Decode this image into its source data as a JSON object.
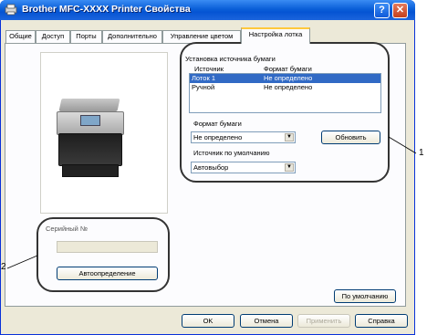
{
  "window": {
    "title": "Brother MFC-XXXX Printer Свойства",
    "help_glyph": "?",
    "close_glyph": "✕"
  },
  "tabs": [
    {
      "label": "Общие"
    },
    {
      "label": "Доступ"
    },
    {
      "label": "Порты"
    },
    {
      "label": "Дополнительно"
    },
    {
      "label": "Управление цветом"
    },
    {
      "label": "Настройка лотка"
    }
  ],
  "paper_source": {
    "group_title": "Установка источника бумаги",
    "col_source": "Источник",
    "col_format": "Формат бумаги",
    "rows": [
      {
        "source": "Лоток 1",
        "format": "Не определено"
      },
      {
        "source": "Ручной",
        "format": "Не определено"
      }
    ],
    "format_label": "Формат бумаги",
    "format_value": "Не определено",
    "update_button": "Обновить",
    "default_source_label": "Источник по умолчанию",
    "default_source_value": "Автовыбор"
  },
  "serial": {
    "group_title": "Серийный №",
    "value": "",
    "autodetect_button": "Автоопределение"
  },
  "buttons": {
    "defaults": "По умолчанию",
    "ok": "OK",
    "cancel": "Отмена",
    "apply": "Применить",
    "help": "Справка"
  },
  "callouts": {
    "one": "1",
    "two": "2"
  },
  "colors": {
    "selection": "#316ac5",
    "titlebar": "#0a5fd8",
    "active_tab_accent": "#ffc83c"
  }
}
